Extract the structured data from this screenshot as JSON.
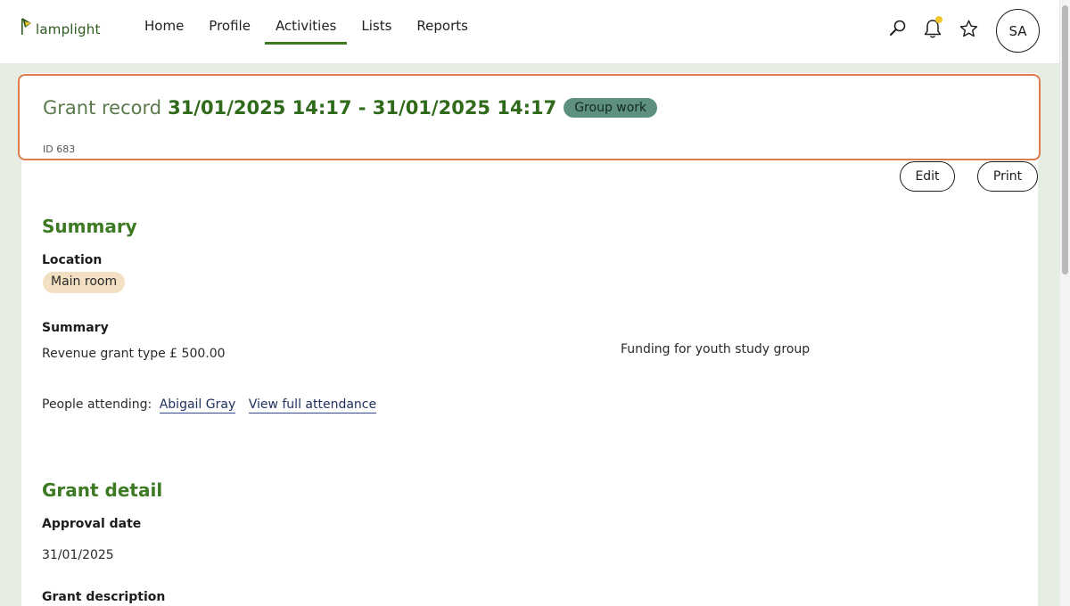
{
  "app": {
    "logo_text": "lamplight"
  },
  "nav": {
    "items": [
      {
        "label": "Home"
      },
      {
        "label": "Profile"
      },
      {
        "label": "Activities"
      },
      {
        "label": "Lists"
      },
      {
        "label": "Reports"
      }
    ],
    "active": "Activities"
  },
  "toolbar": {
    "search_icon": "search-icon",
    "notifications_icon": "bell-icon",
    "favourites_icon": "star-icon",
    "avatar_initials": "SA"
  },
  "record": {
    "title_prefix": "Grant record",
    "title_dates": "31/01/2025 14:17 - 31/01/2025 14:17",
    "type_badge": "Group work",
    "id_text": "ID 683"
  },
  "actions": {
    "edit_label": "Edit",
    "print_label": "Print"
  },
  "summary": {
    "heading": "Summary",
    "location_label": "Location",
    "location_value": "Main room",
    "summary_label": "Summary",
    "summary_value": "Revenue grant type £ 500.00",
    "summary_note": "Funding for youth study group",
    "attending_prefix": "People attending:",
    "attendee_link": "Abigail Gray",
    "full_attendance_link": "View full attendance"
  },
  "grant_detail": {
    "heading": "Grant detail",
    "approval_label": "Approval date",
    "approval_value": "31/01/2025",
    "description_label": "Grant description"
  },
  "colors": {
    "brand_green": "#3d7a23",
    "page_background": "#e6eee3",
    "header_highlight": "#e07a4f",
    "badge_teal": "#5e9081",
    "location_tag": "#f3dfc1",
    "notification_dot": "#f0c42c"
  }
}
